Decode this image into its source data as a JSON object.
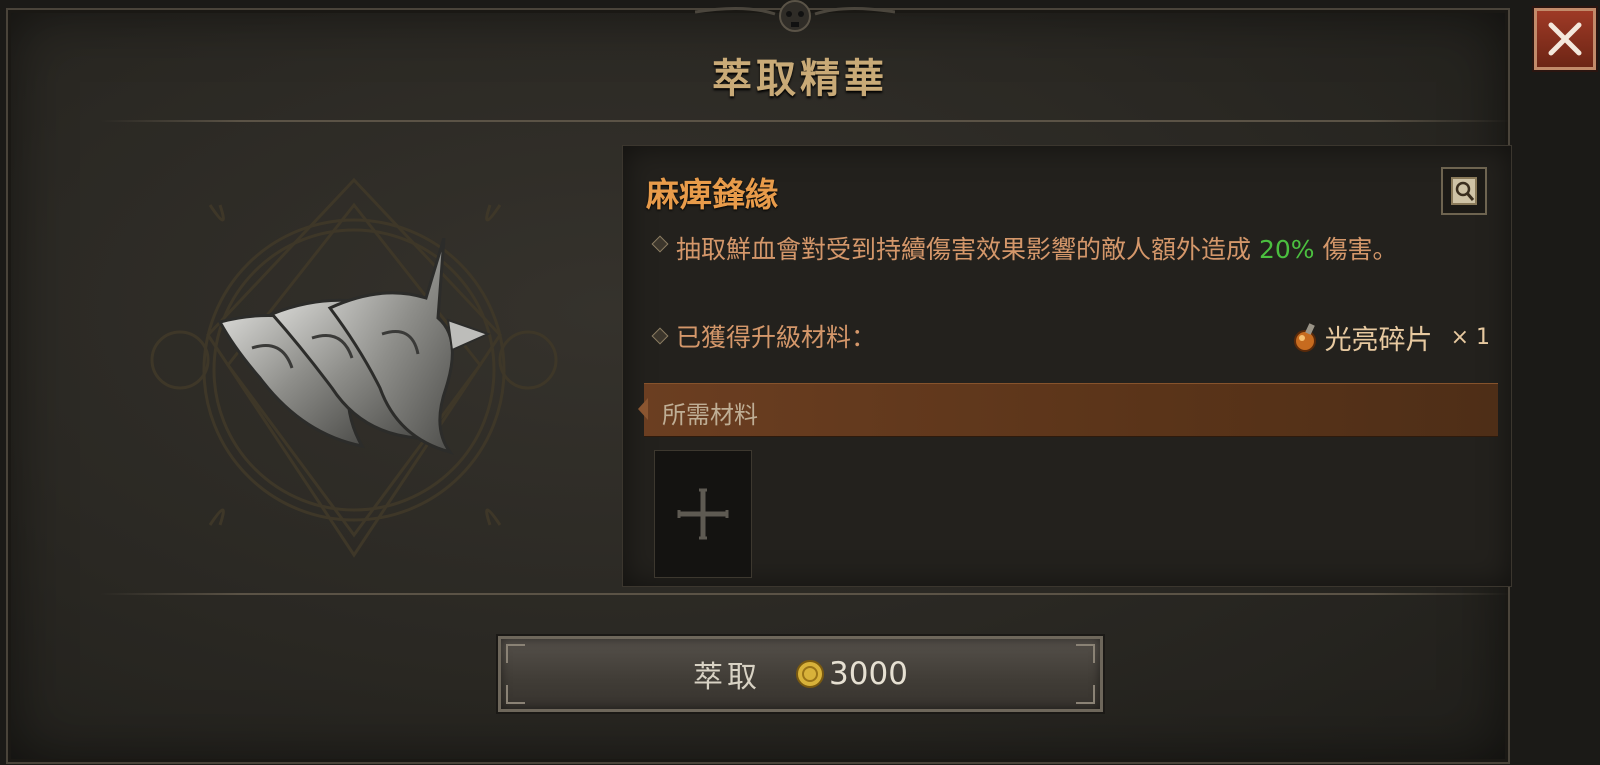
{
  "dialog": {
    "title": "萃取精華",
    "close_icon": "close-icon"
  },
  "item": {
    "name": "麻痺鋒緣",
    "inspect_icon": "magnify-scroll-icon",
    "description_prefix": "抽取鮮血會對受到持續傷害效果影響的敵人額外造成 ",
    "description_value": "20%",
    "description_suffix": " 傷害。",
    "upgrade_label": "已獲得升級材料：",
    "material_name": "光亮碎片",
    "material_count": "× 1",
    "material_icon": "potion-shard-icon"
  },
  "requirements": {
    "header": "所需材料",
    "slot_icon": "cross-icon"
  },
  "action": {
    "label": "萃取",
    "cost": "3000",
    "currency_icon": "gold-coin-icon"
  },
  "colors": {
    "accent_title": "#c9aa77",
    "item_name": "#e89b4a",
    "description": "#d4976a",
    "highlight_value": "#4bbf3f",
    "close_button": "#9e3a26",
    "requirement_bar": "#6b3e21"
  }
}
